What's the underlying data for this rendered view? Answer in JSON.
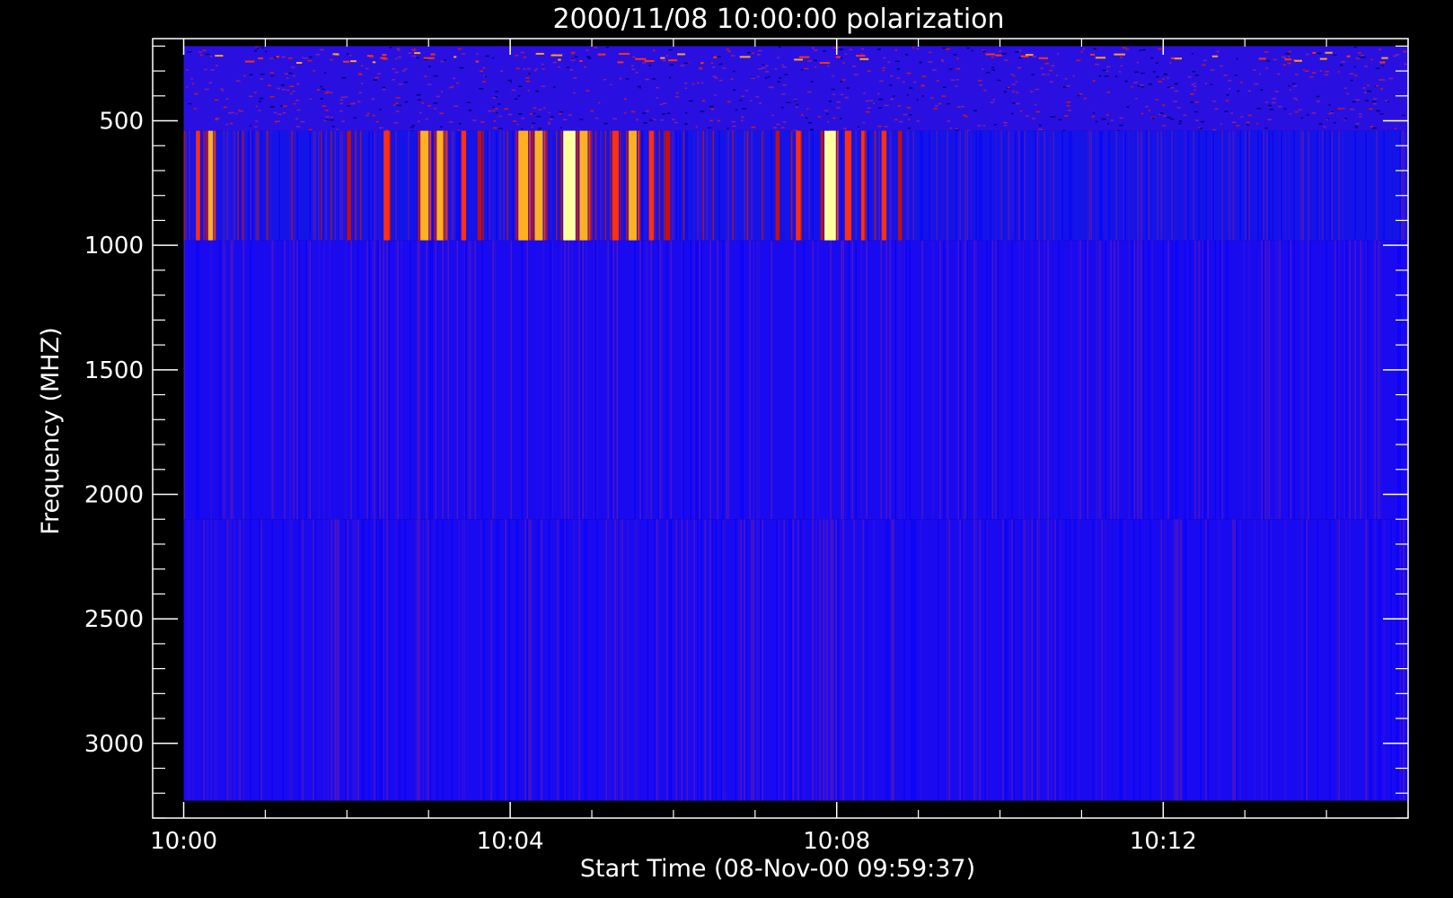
{
  "chart_data": {
    "type": "heatmap",
    "title": "2000/11/08 10:00:00 polarization",
    "xlabel": "Start Time (08-Nov-00 09:59:37)",
    "ylabel": "Frequency (MHZ)",
    "xlim_minutes_after_1000": [
      -0.38,
      15.0
    ],
    "ylim": [
      3300,
      170
    ],
    "x_ticks": [
      "10:00",
      "10:04",
      "10:08",
      "10:12"
    ],
    "x_tick_minutes": [
      0,
      4,
      8,
      12
    ],
    "y_ticks": [
      500,
      1000,
      1500,
      2000,
      2500,
      3000
    ],
    "data_time_range_minutes": [
      0,
      15
    ],
    "bands": [
      {
        "name": "band-1",
        "freq_range": [
          200,
          540
        ],
        "texture": "speckled",
        "base_color": "#2a10e0"
      },
      {
        "name": "band-2",
        "freq_range": [
          540,
          980
        ],
        "texture": "vertical-stripes",
        "base_color": "#1414e8"
      },
      {
        "name": "band-3",
        "freq_range": [
          980,
          2100
        ],
        "texture": "fine-stripes",
        "base_color": "#1a0af0"
      },
      {
        "name": "band-4",
        "freq_range": [
          2100,
          3230
        ],
        "texture": "fine-stripes",
        "base_color": "#1a0af0"
      }
    ],
    "bursts_band_2": [
      {
        "t": 0.15,
        "w": 0.05,
        "level": 0.7
      },
      {
        "t": 0.3,
        "w": 0.06,
        "level": 0.85
      },
      {
        "t": 2.0,
        "w": 0.05,
        "level": 0.6
      },
      {
        "t": 2.45,
        "w": 0.08,
        "level": 0.7
      },
      {
        "t": 2.9,
        "w": 0.1,
        "level": 0.9
      },
      {
        "t": 3.1,
        "w": 0.1,
        "level": 0.85
      },
      {
        "t": 3.4,
        "w": 0.06,
        "level": 0.7
      },
      {
        "t": 3.6,
        "w": 0.05,
        "level": 0.6
      },
      {
        "t": 4.1,
        "w": 0.12,
        "level": 0.85
      },
      {
        "t": 4.3,
        "w": 0.1,
        "level": 0.9
      },
      {
        "t": 4.65,
        "w": 0.15,
        "level": 1.0
      },
      {
        "t": 4.85,
        "w": 0.1,
        "level": 0.9
      },
      {
        "t": 5.25,
        "w": 0.08,
        "level": 0.8
      },
      {
        "t": 5.45,
        "w": 0.1,
        "level": 0.85
      },
      {
        "t": 5.7,
        "w": 0.06,
        "level": 0.7
      },
      {
        "t": 5.9,
        "w": 0.06,
        "level": 0.65
      },
      {
        "t": 7.25,
        "w": 0.05,
        "level": 0.6
      },
      {
        "t": 7.5,
        "w": 0.06,
        "level": 0.7
      },
      {
        "t": 7.85,
        "w": 0.14,
        "level": 1.0
      },
      {
        "t": 8.1,
        "w": 0.08,
        "level": 0.8
      },
      {
        "t": 8.3,
        "w": 0.06,
        "level": 0.7
      },
      {
        "t": 8.55,
        "w": 0.06,
        "level": 0.7
      },
      {
        "t": 8.75,
        "w": 0.05,
        "level": 0.6
      }
    ],
    "burst_end_minute": 8.85,
    "grid": false,
    "legend": "none"
  }
}
